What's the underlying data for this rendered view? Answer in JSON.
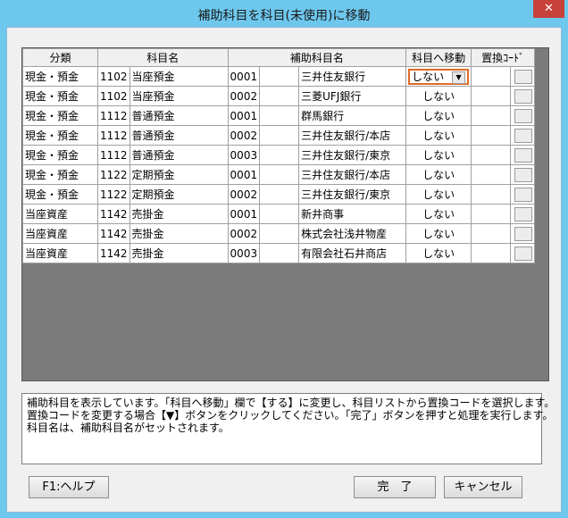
{
  "window": {
    "title": "補助科目を科目(未使用)に移動",
    "close_label": "✕"
  },
  "table": {
    "headers": [
      "分類",
      "科目名",
      "補助科目名",
      "科目へ移動",
      "置換ｺｰﾄﾞ"
    ],
    "rows": [
      {
        "category": "現金・預金",
        "acct_code": "1102",
        "acct_name": "当座預金",
        "sub_code": "0001",
        "sub_name": "三井住友銀行",
        "move": "しない"
      },
      {
        "category": "現金・預金",
        "acct_code": "1102",
        "acct_name": "当座預金",
        "sub_code": "0002",
        "sub_name": "三菱UFJ銀行",
        "move": "しない"
      },
      {
        "category": "現金・預金",
        "acct_code": "1112",
        "acct_name": "普通預金",
        "sub_code": "0001",
        "sub_name": "群馬銀行",
        "move": "しない"
      },
      {
        "category": "現金・預金",
        "acct_code": "1112",
        "acct_name": "普通預金",
        "sub_code": "0002",
        "sub_name": "三井住友銀行/本店",
        "move": "しない"
      },
      {
        "category": "現金・預金",
        "acct_code": "1112",
        "acct_name": "普通預金",
        "sub_code": "0003",
        "sub_name": "三井住友銀行/東京",
        "move": "しない"
      },
      {
        "category": "現金・預金",
        "acct_code": "1122",
        "acct_name": "定期預金",
        "sub_code": "0001",
        "sub_name": "三井住友銀行/本店",
        "move": "しない"
      },
      {
        "category": "現金・預金",
        "acct_code": "1122",
        "acct_name": "定期預金",
        "sub_code": "0002",
        "sub_name": "三井住友銀行/東京",
        "move": "しない"
      },
      {
        "category": "当座資産",
        "acct_code": "1142",
        "acct_name": "売掛金",
        "sub_code": "0001",
        "sub_name": "新井商事",
        "move": "しない"
      },
      {
        "category": "当座資産",
        "acct_code": "1142",
        "acct_name": "売掛金",
        "sub_code": "0002",
        "sub_name": "株式会社浅井物産",
        "move": "しない"
      },
      {
        "category": "当座資産",
        "acct_code": "1142",
        "acct_name": "売掛金",
        "sub_code": "0003",
        "sub_name": "有限会社石井商店",
        "move": "しない"
      }
    ],
    "dropdown_arrow": "▼"
  },
  "description": [
    "補助科目を表示しています。「科目へ移動」欄で【する】に変更し、科目リストから置換コードを選択します。",
    "置換コードを変更する場合【▼】ボタンをクリックしてください。「完了」ボタンを押すと処理を実行します。",
    "科目名は、補助科目名がセットされます。"
  ],
  "buttons": {
    "help": "F1:ヘルプ",
    "done": "完　了",
    "cancel": "キャンセル"
  },
  "colors": {
    "frame": "#6ec8ee",
    "close": "#c7423a",
    "highlight": "#e26a24",
    "grid_bg": "#7b7b7b"
  }
}
